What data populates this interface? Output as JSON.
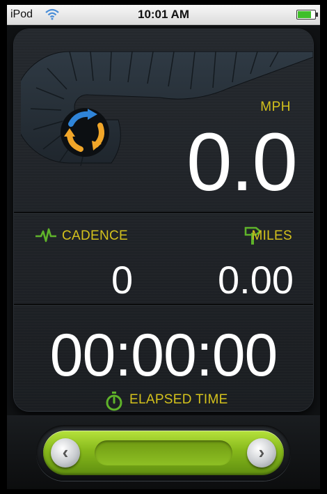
{
  "status_bar": {
    "carrier": "iPod",
    "time": "10:01 AM",
    "wifi_icon": "wifi-icon",
    "battery_icon": "battery-icon"
  },
  "speed": {
    "unit_label": "MPH",
    "value": "0.0",
    "sync_icon": "sync-icon"
  },
  "cadence": {
    "label": "CADENCE",
    "value": "0",
    "icon": "pulse-icon"
  },
  "distance": {
    "label": "MILES",
    "value": "0.00",
    "icon": "signpost-icon"
  },
  "elapsed": {
    "value": "00:00:00",
    "label": "ELAPSED TIME",
    "icon": "stopwatch-icon"
  },
  "slider": {
    "left_glyph": "‹",
    "right_glyph": "›"
  },
  "colors": {
    "accent": "#d4c21c",
    "slider_green": "#86b81b",
    "background": "#101214"
  }
}
